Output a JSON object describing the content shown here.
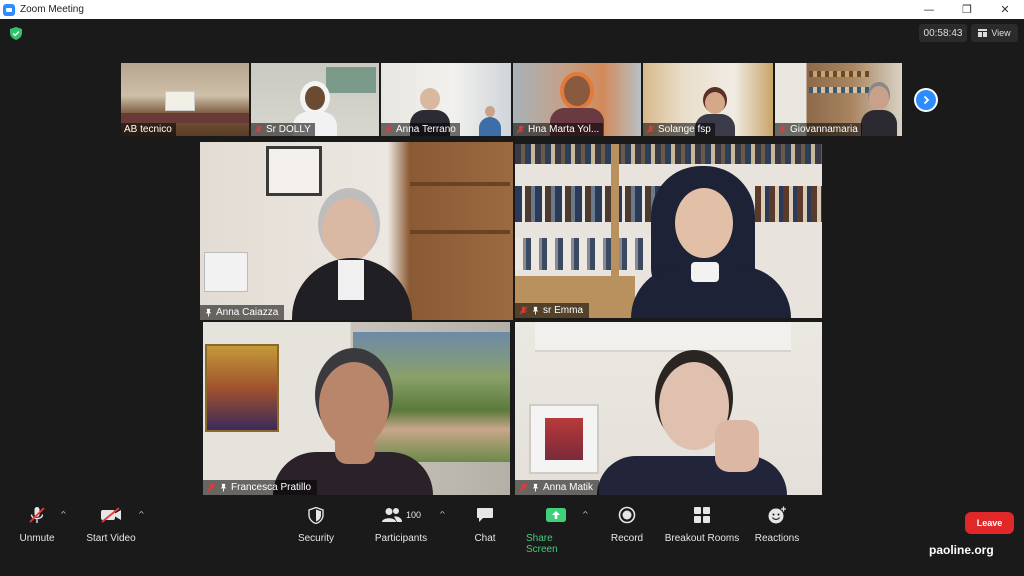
{
  "window": {
    "title": "Zoom Meeting",
    "minimize": "—",
    "restore": "❐",
    "close": "✕"
  },
  "header": {
    "timer": "00:58:43",
    "view_label": "View"
  },
  "thumbnails": [
    {
      "name": "AB tecnico",
      "muted": false
    },
    {
      "name": "Sr DOLLY",
      "muted": true
    },
    {
      "name": "Anna Terrano",
      "muted": true
    },
    {
      "name": "Hna Marta Yol...",
      "muted": true
    },
    {
      "name": "Solange fsp",
      "muted": true
    },
    {
      "name": "Giovannamaria",
      "muted": true
    }
  ],
  "tiles": [
    {
      "name": "Anna Caiazza",
      "muted": false,
      "pinned": true
    },
    {
      "name": "sr Emma",
      "muted": true,
      "pinned": true
    },
    {
      "name": "Francesca Pratillo",
      "muted": true,
      "pinned": true
    },
    {
      "name": "Anna Matik",
      "muted": true,
      "pinned": true
    }
  ],
  "toolbar": {
    "unmute": "Unmute",
    "start_video": "Start Video",
    "security": "Security",
    "participants": "Participants",
    "participants_count": "100",
    "chat": "Chat",
    "share_screen": "Share Screen",
    "record": "Record",
    "breakout_rooms": "Breakout Rooms",
    "reactions": "Reactions",
    "leave": "Leave"
  },
  "watermark": "paoline.org",
  "colors": {
    "active_speaker": "#c5e35b",
    "share_green": "#3fd07a",
    "leave_red": "#e02828",
    "zoom_blue": "#2d8cff"
  }
}
